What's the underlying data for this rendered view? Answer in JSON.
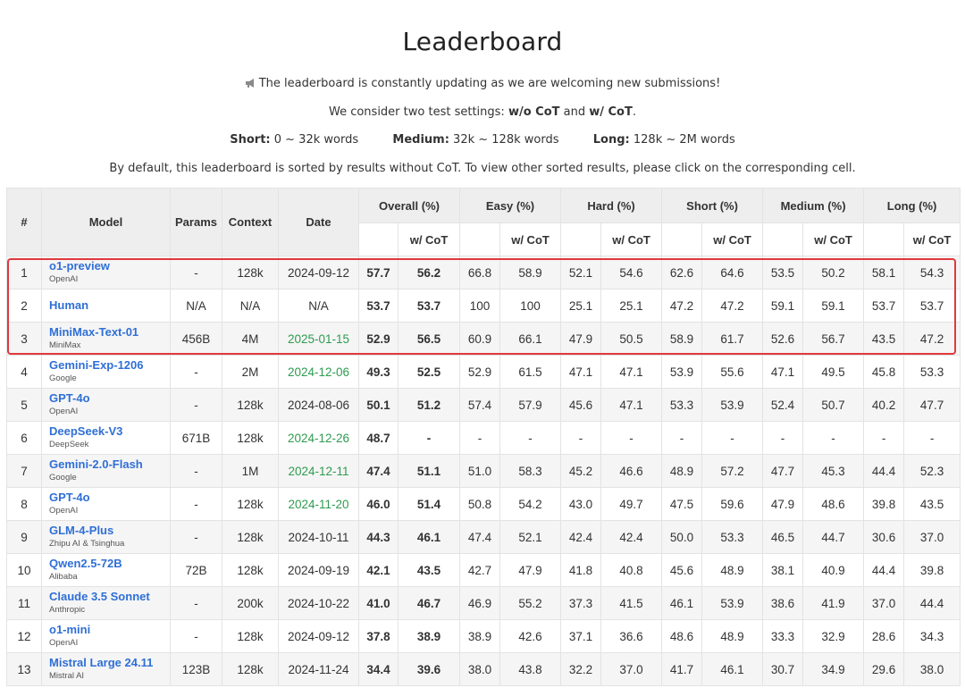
{
  "page": {
    "title": "Leaderboard",
    "line1": "The leaderboard is constantly updating as we are welcoming new submissions!",
    "line2": {
      "prefix": "We consider two test settings: ",
      "opt1": "w/o CoT",
      "mid": " and ",
      "opt2": "w/ CoT",
      "suffix": "."
    },
    "line3": {
      "short_label": "Short:",
      "short_value": " 0 ~ 32k words",
      "medium_label": "Medium:",
      "medium_value": " 32k ~ 128k words",
      "long_label": "Long:",
      "long_value": " 128k ~ 2M words"
    },
    "line4": "By default, this leaderboard is sorted by results without CoT. To view other sorted results, please click on the corresponding cell."
  },
  "colors": {
    "accent": "#2f6fd6",
    "highlight": "#e0393e",
    "date_green": "#2e9b4f"
  },
  "table": {
    "headers": {
      "rank": "#",
      "model": "Model",
      "params": "Params",
      "context": "Context",
      "date": "Date",
      "groups": [
        "Overall (%)",
        "Easy (%)",
        "Hard (%)",
        "Short (%)",
        "Medium (%)",
        "Long (%)"
      ],
      "sub_cot": "w/ CoT"
    },
    "rows": [
      {
        "rank": "1",
        "name": "o1-preview",
        "org": "OpenAI",
        "params": "-",
        "context": "128k",
        "date": "2024-09-12",
        "date_green": false,
        "scores": [
          "57.7",
          "56.2",
          "66.8",
          "58.9",
          "52.1",
          "54.6",
          "62.6",
          "64.6",
          "53.5",
          "50.2",
          "58.1",
          "54.3"
        ]
      },
      {
        "rank": "2",
        "name": "Human",
        "org": "",
        "params": "N/A",
        "context": "N/A",
        "date": "N/A",
        "date_green": false,
        "scores": [
          "53.7",
          "53.7",
          "100",
          "100",
          "25.1",
          "25.1",
          "47.2",
          "47.2",
          "59.1",
          "59.1",
          "53.7",
          "53.7"
        ]
      },
      {
        "rank": "3",
        "name": "MiniMax-Text-01",
        "org": "MiniMax",
        "params": "456B",
        "context": "4M",
        "date": "2025-01-15",
        "date_green": true,
        "scores": [
          "52.9",
          "56.5",
          "60.9",
          "66.1",
          "47.9",
          "50.5",
          "58.9",
          "61.7",
          "52.6",
          "56.7",
          "43.5",
          "47.2"
        ]
      },
      {
        "rank": "4",
        "name": "Gemini-Exp-1206",
        "org": "Google",
        "params": "-",
        "context": "2M",
        "date": "2024-12-06",
        "date_green": true,
        "scores": [
          "49.3",
          "52.5",
          "52.9",
          "61.5",
          "47.1",
          "47.1",
          "53.9",
          "55.6",
          "47.1",
          "49.5",
          "45.8",
          "53.3"
        ]
      },
      {
        "rank": "5",
        "name": "GPT-4o",
        "org": "OpenAI",
        "params": "-",
        "context": "128k",
        "date": "2024-08-06",
        "date_green": false,
        "scores": [
          "50.1",
          "51.2",
          "57.4",
          "57.9",
          "45.6",
          "47.1",
          "53.3",
          "53.9",
          "52.4",
          "50.7",
          "40.2",
          "47.7"
        ]
      },
      {
        "rank": "6",
        "name": "DeepSeek-V3",
        "org": "DeepSeek",
        "params": "671B",
        "context": "128k",
        "date": "2024-12-26",
        "date_green": true,
        "scores": [
          "48.7",
          "-",
          "-",
          "-",
          "-",
          "-",
          "-",
          "-",
          "-",
          "-",
          "-",
          "-"
        ]
      },
      {
        "rank": "7",
        "name": "Gemini-2.0-Flash",
        "org": "Google",
        "params": "-",
        "context": "1M",
        "date": "2024-12-11",
        "date_green": true,
        "scores": [
          "47.4",
          "51.1",
          "51.0",
          "58.3",
          "45.2",
          "46.6",
          "48.9",
          "57.2",
          "47.7",
          "45.3",
          "44.4",
          "52.3"
        ]
      },
      {
        "rank": "8",
        "name": "GPT-4o",
        "org": "OpenAI",
        "params": "-",
        "context": "128k",
        "date": "2024-11-20",
        "date_green": true,
        "scores": [
          "46.0",
          "51.4",
          "50.8",
          "54.2",
          "43.0",
          "49.7",
          "47.5",
          "59.6",
          "47.9",
          "48.6",
          "39.8",
          "43.5"
        ]
      },
      {
        "rank": "9",
        "name": "GLM-4-Plus",
        "org": "Zhipu AI & Tsinghua",
        "params": "-",
        "context": "128k",
        "date": "2024-10-11",
        "date_green": false,
        "scores": [
          "44.3",
          "46.1",
          "47.4",
          "52.1",
          "42.4",
          "42.4",
          "50.0",
          "53.3",
          "46.5",
          "44.7",
          "30.6",
          "37.0"
        ]
      },
      {
        "rank": "10",
        "name": "Qwen2.5-72B",
        "org": "Alibaba",
        "params": "72B",
        "context": "128k",
        "date": "2024-09-19",
        "date_green": false,
        "scores": [
          "42.1",
          "43.5",
          "42.7",
          "47.9",
          "41.8",
          "40.8",
          "45.6",
          "48.9",
          "38.1",
          "40.9",
          "44.4",
          "39.8"
        ]
      },
      {
        "rank": "11",
        "name": "Claude 3.5 Sonnet",
        "org": "Anthropic",
        "params": "-",
        "context": "200k",
        "date": "2024-10-22",
        "date_green": false,
        "scores": [
          "41.0",
          "46.7",
          "46.9",
          "55.2",
          "37.3",
          "41.5",
          "46.1",
          "53.9",
          "38.6",
          "41.9",
          "37.0",
          "44.4"
        ]
      },
      {
        "rank": "12",
        "name": "o1-mini",
        "org": "OpenAI",
        "params": "-",
        "context": "128k",
        "date": "2024-09-12",
        "date_green": false,
        "scores": [
          "37.8",
          "38.9",
          "38.9",
          "42.6",
          "37.1",
          "36.6",
          "48.6",
          "48.9",
          "33.3",
          "32.9",
          "28.6",
          "34.3"
        ]
      },
      {
        "rank": "13",
        "name": "Mistral Large 24.11",
        "org": "Mistral AI",
        "params": "123B",
        "context": "128k",
        "date": "2024-11-24",
        "date_green": false,
        "scores": [
          "34.4",
          "39.6",
          "38.0",
          "43.8",
          "32.2",
          "37.0",
          "41.7",
          "46.1",
          "30.7",
          "34.9",
          "29.6",
          "38.0"
        ]
      }
    ]
  }
}
